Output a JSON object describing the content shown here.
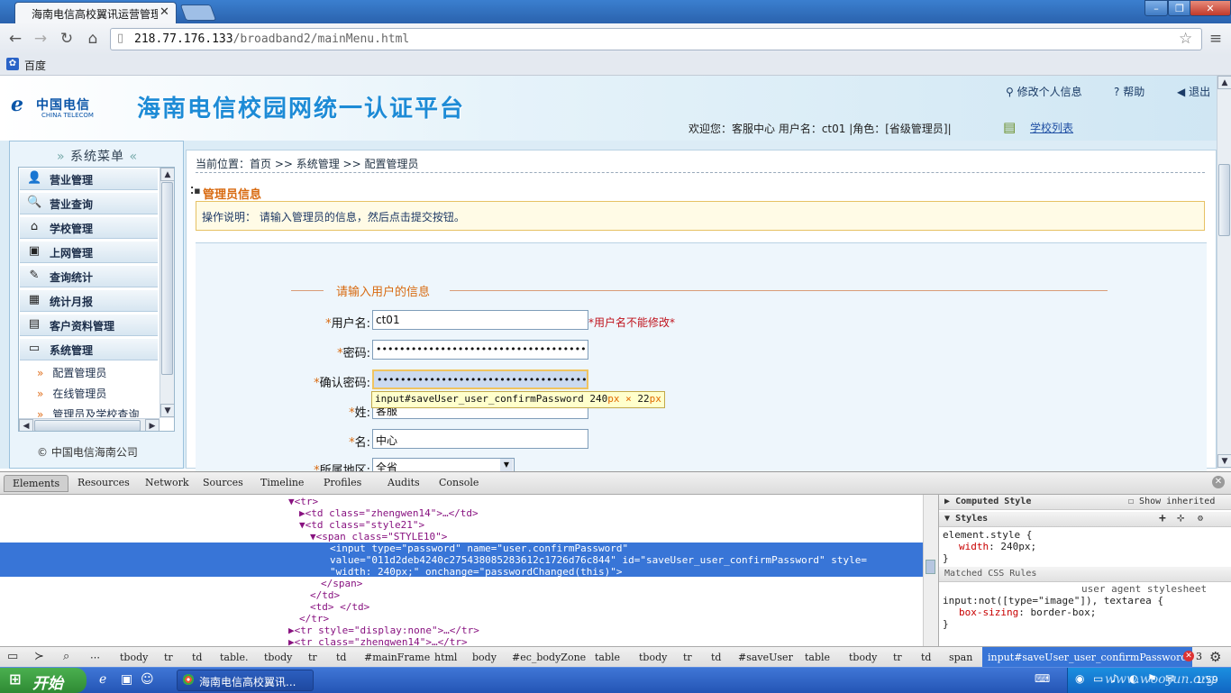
{
  "browser": {
    "tab_title": "海南电信高校翼讯运营管理",
    "url_host": "218.77.176.133",
    "url_path": "/broadband2/mainMenu.html",
    "bookmark": "百度",
    "window_buttons": {
      "minimize": "–",
      "maximize": "❐",
      "close": "✕"
    }
  },
  "header": {
    "logo_cn": "中国电信",
    "logo_en": "CHINA TELECOM",
    "platform_title": "海南电信校园网统一认证平台",
    "links": {
      "edit_profile": "修改个人信息",
      "help": "帮助",
      "logout": "退出"
    },
    "welcome": "欢迎您：客服中心 用户名：ct01 |角色：[省级管理员]|",
    "school_list": "学校列表"
  },
  "sidebar": {
    "title": "系统菜单",
    "items": [
      {
        "label": "营业管理",
        "icon": "user-icon"
      },
      {
        "label": "营业查询",
        "icon": "search-icon"
      },
      {
        "label": "学校管理",
        "icon": "home-icon"
      },
      {
        "label": "上网管理",
        "icon": "computer-icon"
      },
      {
        "label": "查询统计",
        "icon": "notepad-icon"
      },
      {
        "label": "统计月报",
        "icon": "table-icon"
      },
      {
        "label": "客户资料管理",
        "icon": "document-icon"
      },
      {
        "label": "系统管理",
        "icon": "monitor-icon"
      }
    ],
    "sub_items": [
      "配置管理员",
      "在线管理员",
      "管理员及学校查询"
    ],
    "company": "中国电信海南公司"
  },
  "main": {
    "breadcrumb": "当前位置：首页 >> 系统管理 >> 配置管理员",
    "section_title": "管理员信息",
    "note": "操作说明： 请输入管理员的信息，然后点击提交按钮。",
    "legend": "请输入用户的信息",
    "fields": {
      "username": {
        "label": "用户名:",
        "value": "ct01",
        "hint": "*用户名不能修改*"
      },
      "password": {
        "label": "密码:",
        "value": "••••••••••••••••••••••••••••••••••••••••••••••••"
      },
      "confirm_password": {
        "label": "确认密码:",
        "value": "••••••••••••••••••••••••••••••••••••••••••••••••"
      },
      "last_name": {
        "label": "姓:",
        "value": "客服"
      },
      "first_name": {
        "label": "名:",
        "value": "中心"
      },
      "region": {
        "label": "所属地区:",
        "value": "全省"
      }
    },
    "tooltip": {
      "selector": "input#saveUser_user_confirmPassword",
      "w": "240",
      "x": "×",
      "h": "22",
      "unit": "px"
    }
  },
  "devtools": {
    "tabs": [
      "Elements",
      "Resources",
      "Network",
      "Sources",
      "Timeline",
      "Profiles",
      "Audits",
      "Console"
    ],
    "dom_lines": [
      "▼<tr>",
      "▶<td class=\"zhengwen14\">…</td>",
      "▼<td class=\"style21\">",
      "▼<span class=\"STYLE10\">",
      "<input type=\"password\" name=\"user.confirmPassword\"",
      "value=\"011d2deb4240c275438085283612c1726d76c844\" id=\"saveUser_user_confirmPassword\" style=",
      "\"width: 240px;\" onchange=\"passwordChanged(this)\">",
      "</span>",
      "</td>",
      "<td> </td>",
      "</tr>",
      "▶<tr style=\"display:none\">…</tr>",
      "▶<tr class=\"zhengwen14\">…</tr>"
    ],
    "styles": {
      "computed_title": "Computed Style",
      "show_inherited": "Show inherited",
      "styles_title": "Styles",
      "element_style": "element.style {",
      "width_prop": "width",
      "width_value": "240px;",
      "close_brace": "}",
      "matched_title": "Matched CSS Rules",
      "ua_source": "user agent stylesheet",
      "rule_selector": "input:not([type=\"image\"]), textarea {",
      "box_prop": "box-sizing",
      "box_value": "border-box;"
    },
    "breadcrumbs": [
      "tbody",
      "tr",
      "td",
      "table.",
      "tbody",
      "tr",
      "td",
      "#mainFrame",
      "html",
      "body",
      "#ec_bodyZone",
      "table",
      "tbody",
      "tr",
      "td",
      "#saveUser",
      "table",
      "tbody",
      "tr",
      "td",
      "span"
    ],
    "active_crumb": "input#saveUser_user_confirmPassword",
    "error_count": "3"
  },
  "taskbar": {
    "start": "开始",
    "task_label": "海南电信高校翼讯...",
    "clock": "1:59"
  },
  "watermark": "www.wooyun.org"
}
